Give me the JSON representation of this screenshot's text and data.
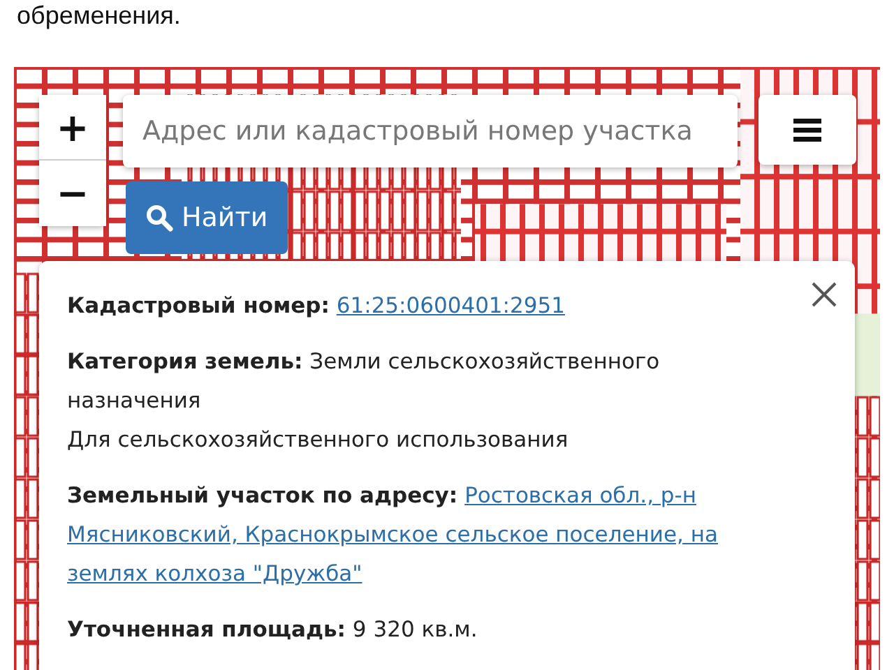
{
  "intro_text": "обременения.",
  "zoom_controls": [
    {
      "label": "+"
    },
    {
      "label": "−"
    }
  ],
  "search": {
    "placeholder": "Адрес или кадастровый номер участка"
  },
  "find_button": {
    "label": "Найти"
  },
  "popup": {
    "fields": [
      {
        "kind": "link",
        "label": "Кадастровый номер:",
        "value_lines": [
          "61:25:0600401:2951"
        ]
      },
      {
        "kind": "text",
        "label": "Категория земель:",
        "value": "Земли сельскохозяйственного назначения"
      },
      {
        "kind": "plain",
        "value": "Для сельскохозяйственного использования"
      },
      {
        "kind": "link",
        "label": "Земельный участок по адресу:",
        "value_lines": [
          "Ростовская обл., р-н",
          "Мясниковский, Краснокрымское сельское поселение, на",
          "землях колхоза \"Дружба\""
        ]
      },
      {
        "kind": "text",
        "label": "Уточненная площадь:",
        "value": "9 320 кв.м."
      }
    ]
  }
}
